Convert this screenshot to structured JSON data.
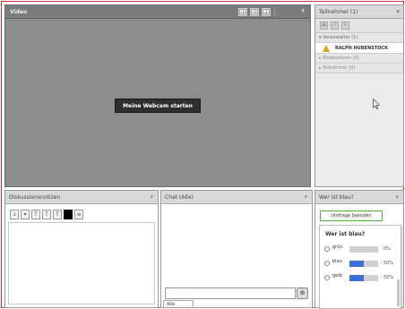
{
  "video": {
    "title": "Video",
    "webcam_button": "Meine Webcam starten",
    "menu_icon": "chevron-down-icon"
  },
  "participants": {
    "title": "Teilnehmer (1)",
    "menu_icon": "chevron-down-icon",
    "groups": [
      {
        "label": "▾ Veranstalter (1)"
      },
      {
        "label": "▸ Moderatoren (0)"
      },
      {
        "label": "▸ Teilnehmer (0)"
      }
    ],
    "user": {
      "name": "RALPH HUBENSTOCK",
      "icon": "presenter-icon"
    }
  },
  "discussion": {
    "title": "Diskussionsnotizen",
    "tools": [
      "↓",
      "▾",
      "T",
      "T",
      "T",
      "■",
      "≡"
    ]
  },
  "chat": {
    "title": "Chat (Alle)",
    "input_placeholder": "",
    "send_label": "⊕",
    "tab_label": "Alle"
  },
  "poll": {
    "title": "Wer ist blau?",
    "button_label": "Umfrage beenden",
    "question": "Wer ist blau?",
    "options": [
      {
        "label": "grün",
        "percent": 0,
        "percent_label": "0%"
      },
      {
        "label": "blau",
        "percent": 50,
        "percent_label": "50%"
      },
      {
        "label": "gelb",
        "percent": 50,
        "percent_label": "50%"
      }
    ],
    "bar_color": "#3c6fd1"
  }
}
